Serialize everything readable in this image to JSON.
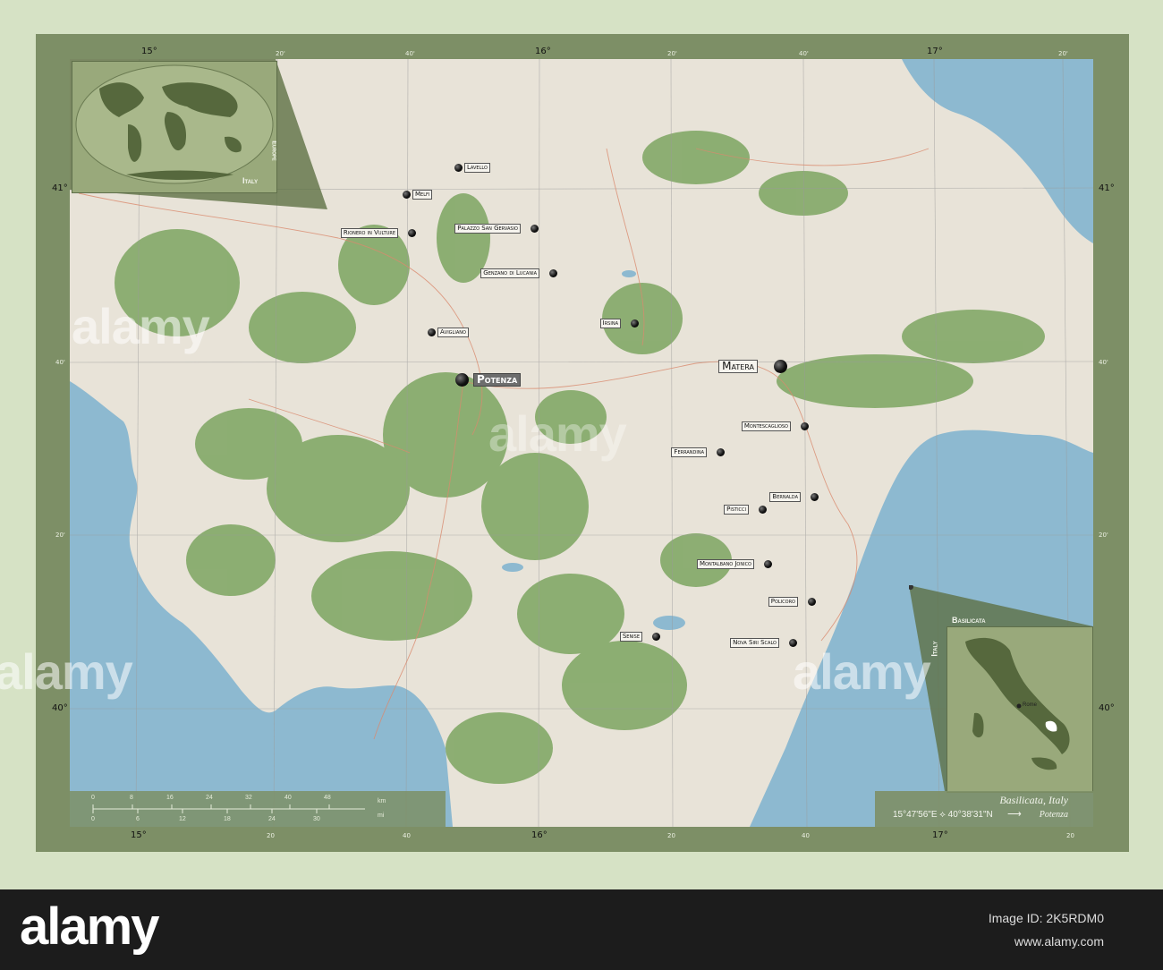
{
  "map": {
    "region_name": "Basilicata",
    "subtitle": "Basilicata, Italy",
    "coordinates": "15°47'56\"E ⟡ 40°38'31\"N",
    "arrow": "⟶",
    "capital_direction_label": "Potenza",
    "top_ticks": [
      "15°",
      "20'",
      "40'",
      "16°",
      "20'",
      "40'",
      "17°",
      "20'"
    ],
    "side_ticks": [
      "41°",
      "40'",
      "20'",
      "40°"
    ],
    "bottom_ticks": [
      "15°",
      "20",
      "40",
      "16°",
      "20",
      "40",
      "17°",
      "20"
    ],
    "right_ticks": [
      "41°",
      "40'",
      "20'",
      "40°"
    ],
    "cities": [
      {
        "name": "Lavello"
      },
      {
        "name": "Melfi"
      },
      {
        "name": "Rionero in Vulture"
      },
      {
        "name": "Palazzo San Gervasio"
      },
      {
        "name": "Genzano di Lucania"
      },
      {
        "name": "Irsina"
      },
      {
        "name": "Avigliano"
      },
      {
        "name": "Potenza"
      },
      {
        "name": "Matera"
      },
      {
        "name": "Montescaglioso"
      },
      {
        "name": "Ferrandina"
      },
      {
        "name": "Bernalda"
      },
      {
        "name": "Pisticci"
      },
      {
        "name": "Montalbano Jonico"
      },
      {
        "name": "Policoro"
      },
      {
        "name": "Senise"
      },
      {
        "name": "Nova Siri Scalo"
      }
    ]
  },
  "inset_world": {
    "label": "Italy",
    "rotated_label": "Europe"
  },
  "inset_italy": {
    "label": "Basilicata",
    "rotated_label": "Italy",
    "city": "Rome"
  },
  "scale_bar": {
    "km_labels": [
      "0",
      "8",
      "16",
      "24",
      "32",
      "40",
      "48"
    ],
    "mi_labels": [
      "0",
      "6",
      "12",
      "18",
      "24",
      "30"
    ],
    "km_unit": "km",
    "mi_unit": "mi"
  },
  "watermark": {
    "text": "alamy"
  },
  "footer": {
    "logo": "alamy",
    "image_id": "Image ID: 2K5RDM0",
    "url": "www.alamy.com"
  },
  "colors": {
    "sea": "#8db9d0",
    "land": "#e8e3d8",
    "forest": "#7da561",
    "frame": "#7d8f66",
    "background": "#d6e2c5"
  }
}
